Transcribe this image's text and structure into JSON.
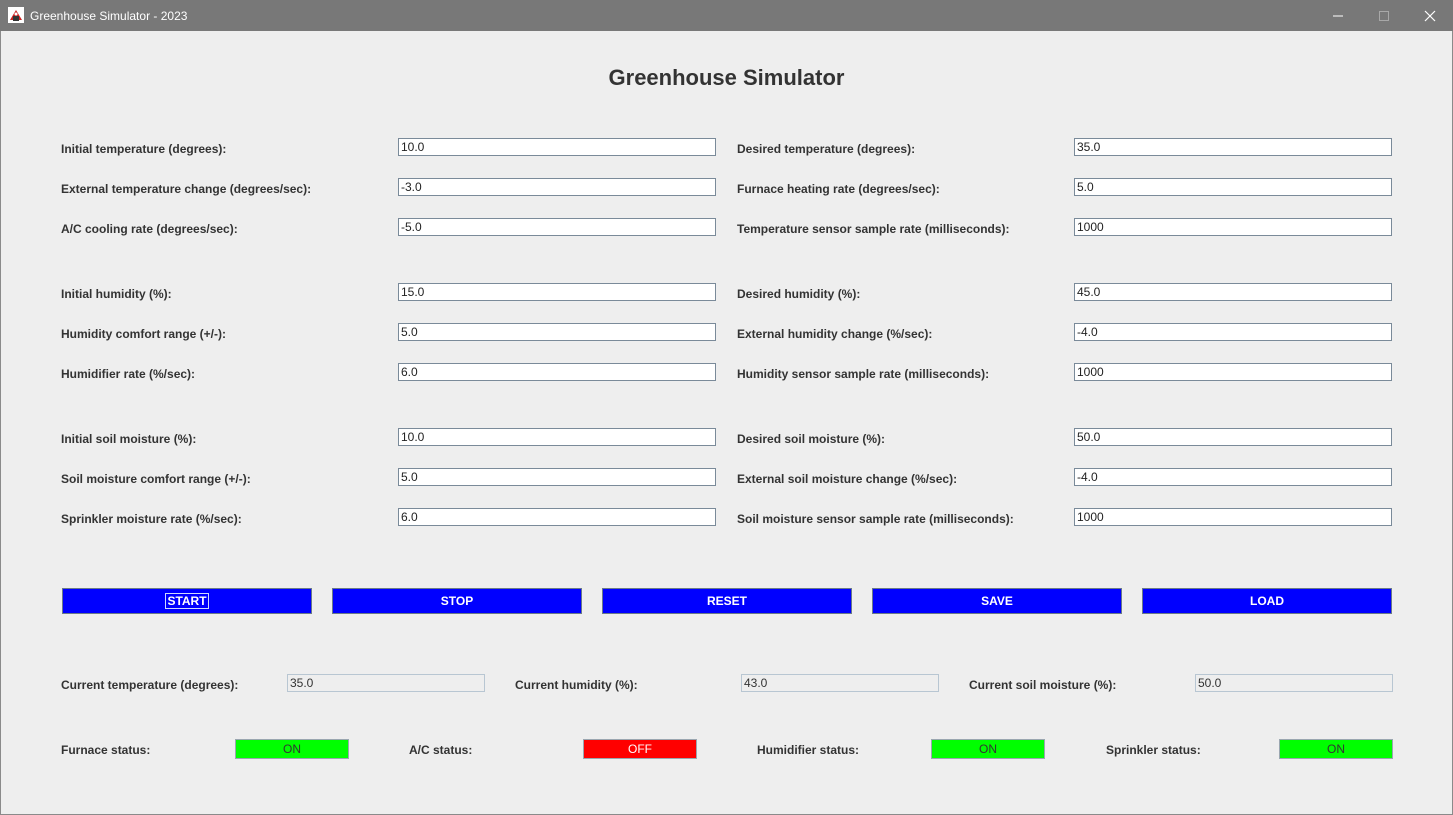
{
  "window": {
    "title": "Greenhouse Simulator - 2023"
  },
  "app": {
    "title": "Greenhouse Simulator"
  },
  "settings": {
    "left": [
      {
        "label": "Initial temperature (degrees):",
        "value": "10.0"
      },
      {
        "label": "External temperature change (degrees/sec):",
        "value": "-3.0"
      },
      {
        "label": "A/C cooling rate (degrees/sec):",
        "value": "-5.0"
      },
      {
        "label": "Initial humidity (%):",
        "value": "15.0"
      },
      {
        "label": "Humidity comfort range (+/-):",
        "value": "5.0"
      },
      {
        "label": "Humidifier rate (%/sec):",
        "value": "6.0"
      },
      {
        "label": "Initial soil moisture (%):",
        "value": "10.0"
      },
      {
        "label": "Soil moisture comfort range (+/-):",
        "value": "5.0"
      },
      {
        "label": "Sprinkler moisture rate (%/sec):",
        "value": "6.0"
      }
    ],
    "right": [
      {
        "label": "Desired temperature (degrees):",
        "value": "35.0"
      },
      {
        "label": "Furnace heating rate (degrees/sec):",
        "value": "5.0"
      },
      {
        "label": "Temperature sensor sample rate (milliseconds):",
        "value": "1000"
      },
      {
        "label": "Desired humidity (%):",
        "value": "45.0"
      },
      {
        "label": "External humidity change (%/sec):",
        "value": "-4.0"
      },
      {
        "label": "Humidity sensor sample rate (milliseconds):",
        "value": "1000"
      },
      {
        "label": "Desired soil moisture (%):",
        "value": "50.0"
      },
      {
        "label": "External soil moisture change (%/sec):",
        "value": "-4.0"
      },
      {
        "label": "Soil moisture sensor sample rate (milliseconds):",
        "value": "1000"
      }
    ]
  },
  "buttons": {
    "start": "START",
    "stop": "STOP",
    "reset": "RESET",
    "save": "SAVE",
    "load": "LOAD"
  },
  "current": [
    {
      "label": "Current temperature (degrees):",
      "value": "35.0"
    },
    {
      "label": "Current humidity (%):",
      "value": "43.0"
    },
    {
      "label": "Current soil moisture (%):",
      "value": "50.0"
    }
  ],
  "statuses": [
    {
      "label": "Furnace status:",
      "value": "ON",
      "color": "#00ff00"
    },
    {
      "label": "A/C status:",
      "value": "OFF",
      "color": "#ff0000"
    },
    {
      "label": "Humidifier status:",
      "value": "ON",
      "color": "#00ff00"
    },
    {
      "label": "Sprinkler status:",
      "value": "ON",
      "color": "#00ff00"
    }
  ],
  "icons": {
    "app": "greenhouse-app-icon",
    "minimize": "minimize-icon",
    "maximize": "maximize-icon",
    "close": "close-icon"
  }
}
